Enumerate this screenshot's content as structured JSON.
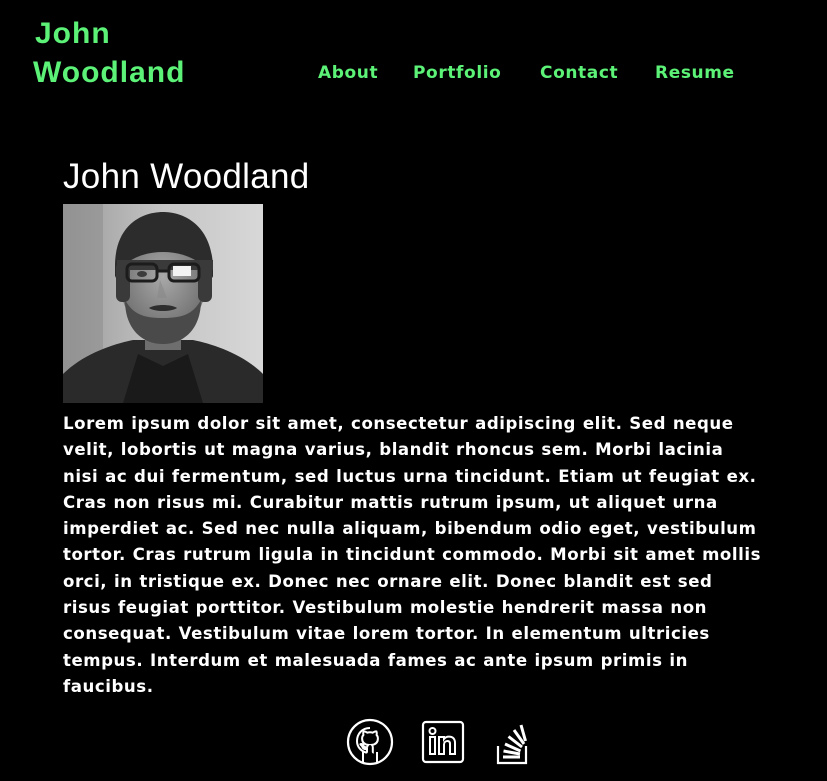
{
  "header": {
    "brand_first": "John",
    "brand_last": "Woodland"
  },
  "nav": {
    "about": "About",
    "portfolio": "Portfolio",
    "contact": "Contact",
    "resume": "Resume"
  },
  "main": {
    "heading": "John Woodland",
    "bio": "Lorem ipsum dolor sit amet, consectetur adipiscing elit. Sed neque velit, lobortis ut magna varius, blandit rhoncus sem. Morbi lacinia nisi ac dui fermentum, sed luctus urna tincidunt. Etiam ut feugiat ex. Cras non risus mi. Curabitur mattis rutrum ipsum, ut aliquet urna imperdiet ac. Sed nec nulla aliquam, bibendum odio eget, vestibulum tortor. Cras rutrum ligula in tincidunt commodo. Morbi sit amet mollis orci, in tristique ex. Donec nec ornare elit. Donec blandit est sed risus feugiat porttitor. Vestibulum molestie hendrerit massa non consequat. Vestibulum vitae lorem tortor. In elementum ultricies tempus. Interdum et malesuada fames ac ante ipsum primis in faucibus."
  },
  "social": {
    "icons": [
      "github-icon",
      "linkedin-icon",
      "stackoverflow-icon"
    ]
  },
  "colors": {
    "accent": "#5cf277",
    "background": "#000000",
    "text": "#ffffff"
  }
}
